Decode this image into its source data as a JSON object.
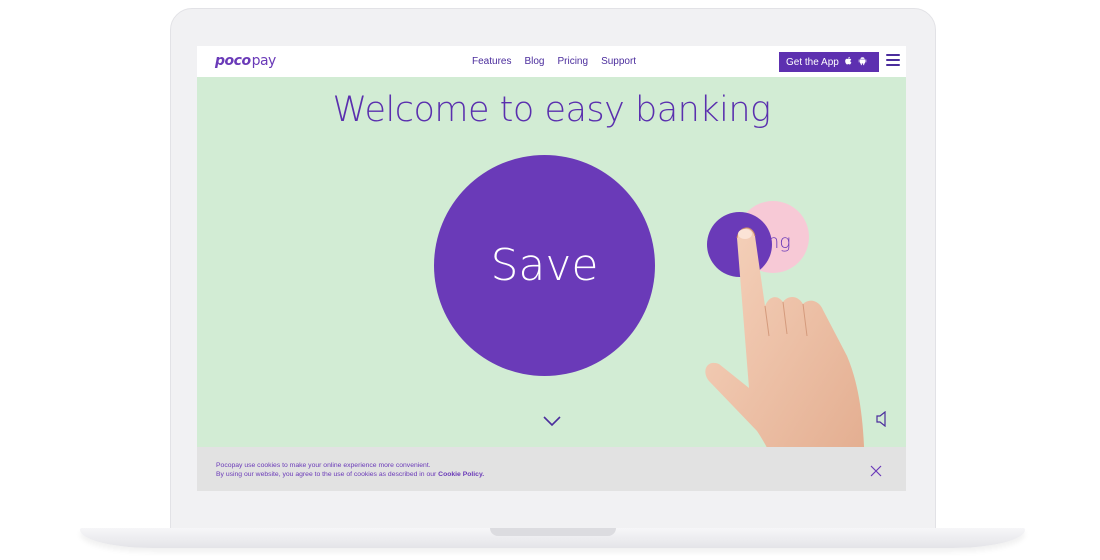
{
  "brand": {
    "logo_part1": "poco",
    "logo_part2": "pay",
    "accent": "#6a3ab8",
    "background": "#d2ecd4",
    "pink": "#f7c9d6"
  },
  "nav": {
    "links": [
      "Features",
      "Blog",
      "Pricing",
      "Support"
    ],
    "get_app_label": "Get the App",
    "icons": [
      "apple-icon",
      "android-icon",
      "hamburger-menu-icon"
    ]
  },
  "hero": {
    "title": "Welcome to easy banking",
    "main_circle_label": "Save",
    "secondary_circle_label": "ing"
  },
  "controls": {
    "icons": [
      "chevron-down-icon",
      "speaker-icon"
    ]
  },
  "cookie": {
    "line1": "Pocopay use cookies to make your online experience more convenient.",
    "line2": "By using our website, you agree to the use of cookies as described in our",
    "link": "Cookie Policy.",
    "close_icon": "close-icon"
  }
}
